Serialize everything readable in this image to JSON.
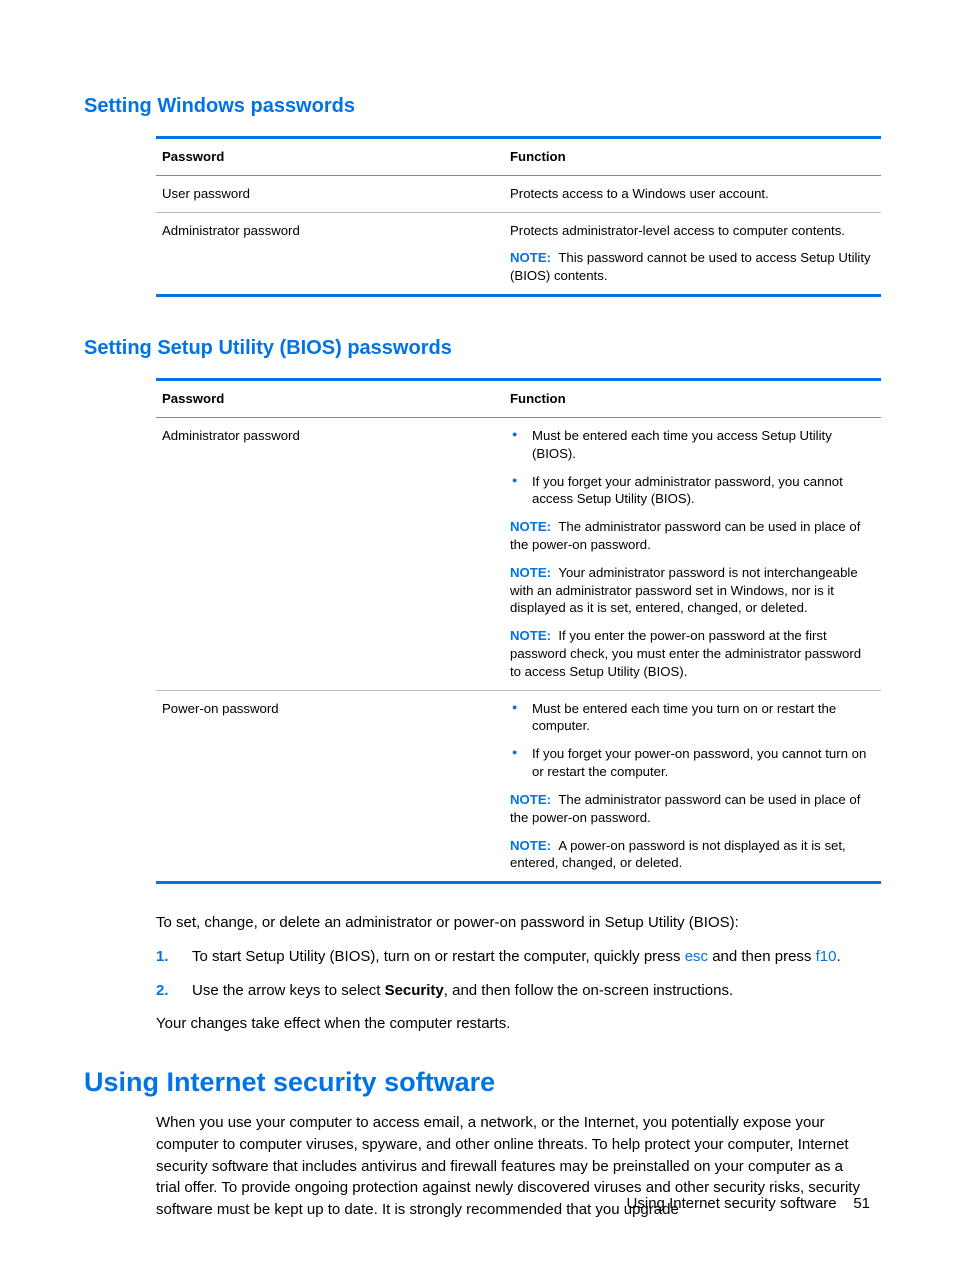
{
  "section1": {
    "heading": "Setting Windows passwords",
    "th_password": "Password",
    "th_function": "Function",
    "rows": [
      {
        "name": "User password",
        "func": "Protects access to a Windows user account."
      },
      {
        "name": "Administrator password",
        "func": "Protects administrator-level access to computer contents.",
        "note_label": "NOTE:",
        "note": "This password cannot be used to access Setup Utility (BIOS) contents."
      }
    ]
  },
  "section2": {
    "heading": "Setting Setup Utility (BIOS) passwords",
    "th_password": "Password",
    "th_function": "Function",
    "row_admin": {
      "name": "Administrator password",
      "bul1": "Must be entered each time you access Setup Utility (BIOS).",
      "bul2": "If you forget your administrator password, you cannot access Setup Utility (BIOS).",
      "note1_label": "NOTE:",
      "note1": "The administrator password can be used in place of the power-on password.",
      "note2_label": "NOTE:",
      "note2": "Your administrator password is not interchangeable with an administrator password set in Windows, nor is it displayed as it is set, entered, changed, or deleted.",
      "note3_label": "NOTE:",
      "note3": "If you enter the power-on password at the first password check, you must enter the administrator password to access Setup Utility (BIOS)."
    },
    "row_power": {
      "name": "Power-on password",
      "bul1": "Must be entered each time you turn on or restart the computer.",
      "bul2": "If you forget your power-on password, you cannot turn on or restart the computer.",
      "note1_label": "NOTE:",
      "note1": "The administrator password can be used in place of the power-on password.",
      "note2_label": "NOTE:",
      "note2": "A power-on password is not displayed as it is set, entered, changed, or deleted."
    }
  },
  "instructions": {
    "intro": "To set, change, or delete an administrator or power-on password in Setup Utility (BIOS):",
    "step1_a": "To start Setup Utility (BIOS), turn on or restart the computer, quickly press ",
    "step1_key1": "esc",
    "step1_b": " and then press ",
    "step1_key2": "f10",
    "step1_c": ".",
    "step2_a": "Use the arrow keys to select ",
    "step2_bold": "Security",
    "step2_b": ", and then follow the on-screen instructions.",
    "outro": "Your changes take effect when the computer restarts."
  },
  "section3": {
    "heading": "Using Internet security software",
    "para": "When you use your computer to access email, a network, or the Internet, you potentially expose your computer to computer viruses, spyware, and other online threats. To help protect your computer, Internet security software that includes antivirus and firewall features may be preinstalled on your computer as a trial offer. To provide ongoing protection against newly discovered viruses and other security risks, security software must be kept up to date. It is strongly recommended that you upgrade"
  },
  "footer": {
    "text": "Using Internet security software",
    "page": "51"
  }
}
